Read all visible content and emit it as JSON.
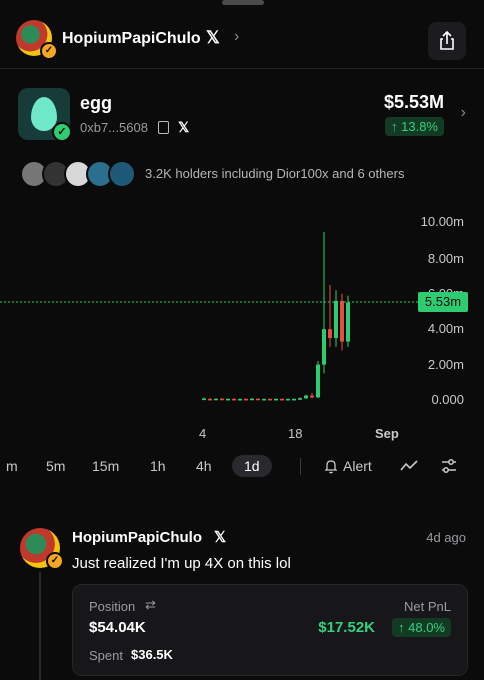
{
  "header": {
    "name": "HopiumPapiChulo"
  },
  "token": {
    "name": "egg",
    "address": "0xb7...5608",
    "price": "$5.53M",
    "change": "↑ 13.8%"
  },
  "holders": {
    "text": "3.2K holders including Dior100x and 6 others"
  },
  "chart_data": {
    "type": "candlestick",
    "y_ticks": [
      "10.00m",
      "8.00m",
      "6.00m",
      "4.00m",
      "2.00m",
      "0.000"
    ],
    "x_ticks": [
      "4",
      "18",
      "Sep"
    ],
    "current_label": "5.53m",
    "ylim": [
      0,
      10.5
    ],
    "candles": [
      {
        "o": 0.05,
        "h": 0.15,
        "l": 0.0,
        "c": 0.08,
        "up": true
      },
      {
        "o": 0.06,
        "h": 0.12,
        "l": 0.0,
        "c": 0.04,
        "up": false
      },
      {
        "o": 0.04,
        "h": 0.1,
        "l": 0.0,
        "c": 0.07,
        "up": true
      },
      {
        "o": 0.07,
        "h": 0.12,
        "l": 0.0,
        "c": 0.05,
        "up": false
      },
      {
        "o": 0.05,
        "h": 0.1,
        "l": 0.0,
        "c": 0.06,
        "up": true
      },
      {
        "o": 0.06,
        "h": 0.11,
        "l": 0.0,
        "c": 0.04,
        "up": false
      },
      {
        "o": 0.04,
        "h": 0.09,
        "l": 0.0,
        "c": 0.06,
        "up": true
      },
      {
        "o": 0.06,
        "h": 0.1,
        "l": 0.0,
        "c": 0.05,
        "up": false
      },
      {
        "o": 0.05,
        "h": 0.12,
        "l": 0.0,
        "c": 0.07,
        "up": true
      },
      {
        "o": 0.07,
        "h": 0.1,
        "l": 0.0,
        "c": 0.05,
        "up": false
      },
      {
        "o": 0.05,
        "h": 0.09,
        "l": 0.0,
        "c": 0.06,
        "up": true
      },
      {
        "o": 0.06,
        "h": 0.1,
        "l": 0.0,
        "c": 0.05,
        "up": false
      },
      {
        "o": 0.05,
        "h": 0.1,
        "l": 0.0,
        "c": 0.06,
        "up": true
      },
      {
        "o": 0.06,
        "h": 0.1,
        "l": 0.0,
        "c": 0.05,
        "up": false
      },
      {
        "o": 0.05,
        "h": 0.09,
        "l": 0.0,
        "c": 0.06,
        "up": true
      },
      {
        "o": 0.06,
        "h": 0.1,
        "l": 0.0,
        "c": 0.05,
        "up": true
      },
      {
        "o": 0.05,
        "h": 0.15,
        "l": 0.0,
        "c": 0.1,
        "up": true
      },
      {
        "o": 0.1,
        "h": 0.3,
        "l": 0.05,
        "c": 0.25,
        "up": true
      },
      {
        "o": 0.25,
        "h": 0.4,
        "l": 0.1,
        "c": 0.15,
        "up": false
      },
      {
        "o": 0.15,
        "h": 2.2,
        "l": 0.1,
        "c": 2.0,
        "up": true
      },
      {
        "o": 2.0,
        "h": 9.5,
        "l": 1.5,
        "c": 4.0,
        "up": true
      },
      {
        "o": 4.0,
        "h": 6.5,
        "l": 3.0,
        "c": 3.5,
        "up": false
      },
      {
        "o": 3.5,
        "h": 6.2,
        "l": 3.0,
        "c": 5.6,
        "up": true
      },
      {
        "o": 5.6,
        "h": 6.0,
        "l": 2.8,
        "c": 3.3,
        "up": false
      },
      {
        "o": 3.3,
        "h": 5.9,
        "l": 3.0,
        "c": 5.5,
        "up": true
      }
    ]
  },
  "timeframes": {
    "items": [
      "m",
      "5m",
      "15m",
      "1h",
      "4h",
      "1d"
    ],
    "alert": "Alert"
  },
  "post": {
    "author": "HopiumPapiChulo",
    "time": "4d ago",
    "text": "Just realized I'm up 4X on this lol",
    "position_label": "Position",
    "position_value": "$54.04K",
    "spent_label": "Spent",
    "spent_value": "$36.5K",
    "pnl_label": "Net PnL",
    "pnl_value": "$17.52K",
    "pnl_pct": "↑ 48.0%"
  },
  "colors": {
    "up": "#2ecc71",
    "down": "#e74c3c",
    "accent": "#35d07f"
  }
}
